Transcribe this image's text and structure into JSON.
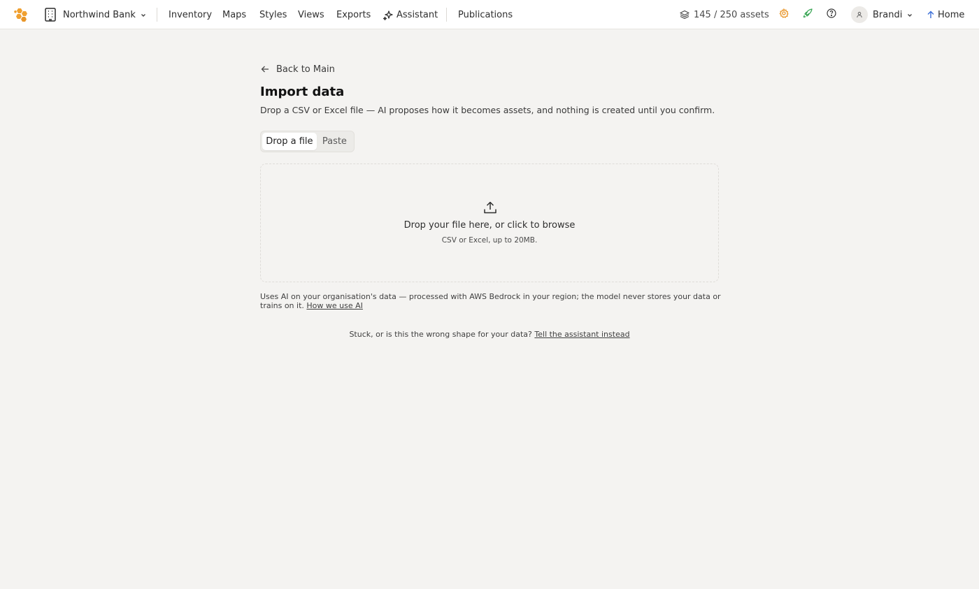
{
  "header": {
    "logo_icon": "honeycomb-logo",
    "org_name": "Northwind Bank",
    "org_icon": "building-icon",
    "nav": [
      {
        "label": "Inventory"
      },
      {
        "label": "Maps"
      },
      {
        "label": "Styles"
      },
      {
        "label": "Views"
      },
      {
        "label": "Exports"
      },
      {
        "label": "Assistant",
        "icon": "sparkles-icon"
      },
      {
        "label": "Publications"
      }
    ],
    "assets_count": "145 / 250 assets",
    "assets_icon": "layers-icon",
    "settings_icon": "gear-icon",
    "rocket_icon": "rocket-icon",
    "help_icon": "help-icon",
    "user_name": "Brandi",
    "home_label": "Home",
    "colors": {
      "brand": "#f0a030",
      "rocket": "#3aa655",
      "home_arrow": "#3b6fd8"
    }
  },
  "page": {
    "back_label": "Back to Main",
    "title": "Import data",
    "subtitle": "Drop a CSV or Excel file — AI proposes how it becomes assets, and nothing is created until you confirm.",
    "tabs": [
      {
        "label": "Drop a file",
        "active": true
      },
      {
        "label": "Paste",
        "active": false
      }
    ],
    "dropzone": {
      "icon": "upload-icon",
      "main": "Drop your file here, or click to browse",
      "sub": "CSV or Excel, up to 20MB."
    },
    "disclaimer": "Uses AI on your organisation's data — processed with AWS Bedrock in your region; the model never stores your data or trains on it.",
    "disclaimer_link": "How we use AI",
    "stuck_text": "Stuck, or is this the wrong shape for your data?",
    "stuck_link": "Tell the assistant instead"
  }
}
